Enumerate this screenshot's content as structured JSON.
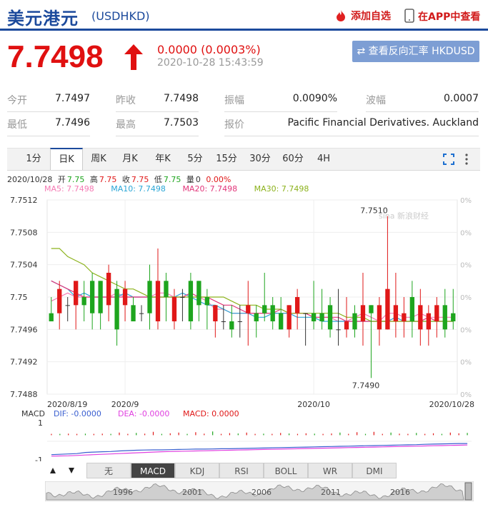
{
  "header": {
    "name": "美元港元",
    "code": "(USDHKD)",
    "watch_label": "添加自选",
    "app_label": "在APP中查看"
  },
  "quote": {
    "price": "7.7498",
    "change": "0.0000 (0.0003%)",
    "time": "2020-10-28 15:43:59",
    "reverse_label": "⇄ 查看反向汇率 HKDUSD",
    "up_color": "#e01010"
  },
  "stats": {
    "row1": [
      {
        "label": "今开",
        "value": "7.7497"
      },
      {
        "label": "昨收",
        "value": "7.7498"
      },
      {
        "label": "振幅",
        "value": "0.0090%"
      },
      {
        "label": "波幅",
        "value": "0.0007"
      }
    ],
    "row2": [
      {
        "label": "最低",
        "value": "7.7496"
      },
      {
        "label": "最高",
        "value": "7.7503"
      },
      {
        "label": "报价",
        "value": "Pacific Financial Derivatives. Auckland"
      }
    ]
  },
  "tabs": [
    "1分",
    "日K",
    "周K",
    "月K",
    "年K",
    "5分",
    "15分",
    "30分",
    "60分",
    "4H"
  ],
  "active_tab": 1,
  "ohlc": {
    "date": "2020/10/28",
    "open_label": "开",
    "open": "7.75",
    "high_label": "高",
    "high": "7.75",
    "close_label": "收",
    "close": "7.75",
    "low_label": "低",
    "low": "7.75",
    "vol_label": "量",
    "vol": "0",
    "pct": "0.00%"
  },
  "ma_legend": [
    {
      "label": "MA5: 7.7498",
      "color": "#f57ab4"
    },
    {
      "label": "MA10: 7.7498",
      "color": "#2aa6d6"
    },
    {
      "label": "MA20: 7.7498",
      "color": "#e2367a"
    },
    {
      "label": "MA30: 7.7498",
      "color": "#8cb21c"
    }
  ],
  "watermark": "sina 新浪财经",
  "macd_legend": {
    "title": "MACD",
    "dif": "DIF: -0.0000",
    "dea": "DEA: -0.0000",
    "macd": "MACD: 0.0000"
  },
  "indicator_tabs": [
    "无",
    "MACD",
    "KDJ",
    "RSI",
    "BOLL",
    "WR",
    "DMI"
  ],
  "active_indicator": 1,
  "navigator": {
    "years": [
      "1996",
      "2001",
      "2006",
      "2011",
      "2016"
    ]
  },
  "chart_data": {
    "type": "candlestick",
    "y_ticks": [
      "7.7512",
      "7.7508",
      "7.7504",
      "7.75",
      "7.7496",
      "7.7492",
      "7.7488"
    ],
    "ylim": [
      7.7488,
      7.7512
    ],
    "right_ticks": [
      "0%",
      "0%",
      "0%",
      "0%",
      "0%",
      "0%",
      "0%"
    ],
    "x_labels": [
      "2020/8/19",
      "2020/9",
      "2020/10",
      "2020/10/28"
    ],
    "x_label_index": [
      0,
      9,
      32,
      49
    ],
    "annotations": [
      {
        "text": "7.7510",
        "index": 39,
        "value": 7.751
      },
      {
        "text": "7.7490",
        "index": 38,
        "value": 7.749
      }
    ],
    "colors": {
      "up": "#e01818",
      "down": "#1ea51e",
      "flat": "#333333"
    },
    "candles": [
      {
        "o": 7.7498,
        "h": 7.75,
        "l": 7.7497,
        "c": 7.7497
      },
      {
        "o": 7.7498,
        "h": 7.7502,
        "l": 7.7496,
        "c": 7.7501
      },
      {
        "o": 7.7499,
        "h": 7.75,
        "l": 7.7497,
        "c": 7.7499
      },
      {
        "o": 7.7499,
        "h": 7.7501,
        "l": 7.7496,
        "c": 7.7502
      },
      {
        "o": 7.75,
        "h": 7.7502,
        "l": 7.7497,
        "c": 7.7499
      },
      {
        "o": 7.7502,
        "h": 7.7503,
        "l": 7.7496,
        "c": 7.7498
      },
      {
        "o": 7.7502,
        "h": 7.7502,
        "l": 7.7496,
        "c": 7.7498
      },
      {
        "o": 7.7499,
        "h": 7.7504,
        "l": 7.7497,
        "c": 7.7503
      },
      {
        "o": 7.7501,
        "h": 7.7502,
        "l": 7.7494,
        "c": 7.7496
      },
      {
        "o": 7.7499,
        "h": 7.7502,
        "l": 7.7497,
        "c": 7.7501
      },
      {
        "o": 7.7499,
        "h": 7.75,
        "l": 7.7497,
        "c": 7.7497
      },
      {
        "o": 7.7498,
        "h": 7.7499,
        "l": 7.7497,
        "c": 7.7498
      },
      {
        "o": 7.7502,
        "h": 7.7504,
        "l": 7.7496,
        "c": 7.7498
      },
      {
        "o": 7.7497,
        "h": 7.7506,
        "l": 7.7496,
        "c": 7.7502
      },
      {
        "o": 7.7502,
        "h": 7.7503,
        "l": 7.7497,
        "c": 7.75
      },
      {
        "o": 7.7497,
        "h": 7.7501,
        "l": 7.7496,
        "c": 7.75
      },
      {
        "o": 7.75,
        "h": 7.7501,
        "l": 7.7497,
        "c": 7.75
      },
      {
        "o": 7.7502,
        "h": 7.7503,
        "l": 7.7496,
        "c": 7.7497
      },
      {
        "o": 7.7502,
        "h": 7.7502,
        "l": 7.7497,
        "c": 7.7499
      },
      {
        "o": 7.75,
        "h": 7.7501,
        "l": 7.7496,
        "c": 7.7499
      },
      {
        "o": 7.7497,
        "h": 7.7499,
        "l": 7.7495,
        "c": 7.7499
      },
      {
        "o": 7.7497,
        "h": 7.7499,
        "l": 7.7496,
        "c": 7.7497
      },
      {
        "o": 7.7497,
        "h": 7.7499,
        "l": 7.7495,
        "c": 7.7496
      },
      {
        "o": 7.7497,
        "h": 7.7499,
        "l": 7.7495,
        "c": 7.7497
      },
      {
        "o": 7.7498,
        "h": 7.7502,
        "l": 7.7494,
        "c": 7.7499
      },
      {
        "o": 7.7498,
        "h": 7.7499,
        "l": 7.7495,
        "c": 7.7497
      },
      {
        "o": 7.7499,
        "h": 7.7503,
        "l": 7.7497,
        "c": 7.7498
      },
      {
        "o": 7.7499,
        "h": 7.75,
        "l": 7.7496,
        "c": 7.7497
      },
      {
        "o": 7.7498,
        "h": 7.75,
        "l": 7.7496,
        "c": 7.7496
      },
      {
        "o": 7.7496,
        "h": 7.7499,
        "l": 7.7495,
        "c": 7.7499
      },
      {
        "o": 7.7498,
        "h": 7.7501,
        "l": 7.7496,
        "c": 7.75
      },
      {
        "o": 7.7498,
        "h": 7.7498,
        "l": 7.7494,
        "c": 7.7498
      },
      {
        "o": 7.7498,
        "h": 7.7502,
        "l": 7.7496,
        "c": 7.7497
      },
      {
        "o": 7.7498,
        "h": 7.7501,
        "l": 7.7496,
        "c": 7.7497
      },
      {
        "o": 7.7499,
        "h": 7.75,
        "l": 7.7495,
        "c": 7.7496
      },
      {
        "o": 7.7496,
        "h": 7.7501,
        "l": 7.7494,
        "c": 7.7496
      },
      {
        "o": 7.7496,
        "h": 7.75,
        "l": 7.7495,
        "c": 7.7497
      },
      {
        "o": 7.7498,
        "h": 7.7499,
        "l": 7.7495,
        "c": 7.7496
      },
      {
        "o": 7.7497,
        "h": 7.7503,
        "l": 7.7494,
        "c": 7.7499
      },
      {
        "o": 7.7499,
        "h": 7.7499,
        "l": 7.749,
        "c": 7.7498
      },
      {
        "o": 7.7496,
        "h": 7.75,
        "l": 7.7494,
        "c": 7.7499
      },
      {
        "o": 7.7496,
        "h": 7.751,
        "l": 7.7496,
        "c": 7.7501
      },
      {
        "o": 7.7497,
        "h": 7.7503,
        "l": 7.7495,
        "c": 7.7499
      },
      {
        "o": 7.7497,
        "h": 7.75,
        "l": 7.7495,
        "c": 7.7498
      },
      {
        "o": 7.75,
        "h": 7.7502,
        "l": 7.7495,
        "c": 7.7497
      },
      {
        "o": 7.7496,
        "h": 7.7501,
        "l": 7.7494,
        "c": 7.7499
      },
      {
        "o": 7.7496,
        "h": 7.7499,
        "l": 7.7494,
        "c": 7.7498
      },
      {
        "o": 7.7497,
        "h": 7.75,
        "l": 7.7495,
        "c": 7.7499
      },
      {
        "o": 7.7499,
        "h": 7.7501,
        "l": 7.7495,
        "c": 7.7496
      },
      {
        "o": 7.7498,
        "h": 7.7501,
        "l": 7.7496,
        "c": 7.7497
      }
    ],
    "ma": [
      {
        "name": "MA5",
        "color": "#f57ab4",
        "values": [
          7.74995,
          7.75,
          7.75005,
          7.75,
          7.75,
          7.75,
          7.75,
          7.75,
          7.75005,
          7.75,
          7.75,
          7.75,
          7.75,
          7.75005,
          7.75005,
          7.75,
          7.75,
          7.75,
          7.75,
          7.74995,
          7.74985,
          7.74985,
          7.7498,
          7.7498,
          7.7498,
          7.7498,
          7.7498,
          7.7498,
          7.7498,
          7.7498,
          7.7498,
          7.7498,
          7.74975,
          7.74975,
          7.74975,
          7.7497,
          7.7497,
          7.74975,
          7.7498,
          7.74975,
          7.7497,
          7.7498,
          7.7498,
          7.74975,
          7.74975,
          7.7498,
          7.74975,
          7.74975,
          7.74975,
          7.74975
        ]
      },
      {
        "name": "MA10",
        "color": "#2aa6d6",
        "values": [
          7.7502,
          7.75015,
          7.7501,
          7.75,
          7.75005,
          7.75,
          7.75,
          7.75,
          7.75,
          7.75005,
          7.75,
          7.75,
          7.75,
          7.75,
          7.75,
          7.75,
          7.75005,
          7.75,
          7.74995,
          7.7499,
          7.7499,
          7.74985,
          7.7498,
          7.7498,
          7.7498,
          7.74975,
          7.74975,
          7.7498,
          7.7498,
          7.7498,
          7.74975,
          7.74975,
          7.74975,
          7.7497,
          7.7497,
          7.7497,
          7.7497,
          7.7497,
          7.7497,
          7.7497,
          7.7497,
          7.7497,
          7.74975,
          7.7497,
          7.7497,
          7.7497,
          7.7497,
          7.7497,
          7.7497,
          7.7497
        ]
      },
      {
        "name": "MA20",
        "color": "#e2367a",
        "values": [
          7.7502,
          7.75015,
          7.7501,
          7.75005,
          7.75,
          7.75,
          7.75,
          7.75,
          7.75,
          7.75,
          7.75,
          7.75,
          7.75,
          7.75,
          7.75,
          7.75,
          7.75,
          7.75005,
          7.75,
          7.75,
          7.74995,
          7.7499,
          7.7499,
          7.74985,
          7.7498,
          7.7498,
          7.7498,
          7.7498,
          7.74985,
          7.7498,
          7.7498,
          7.7498,
          7.74975,
          7.74975,
          7.74975,
          7.74975,
          7.7497,
          7.7497,
          7.7497,
          7.7497,
          7.7497,
          7.7497,
          7.7497,
          7.7497,
          7.7497,
          7.7497,
          7.74975,
          7.7497,
          7.7497,
          7.7497
        ]
      },
      {
        "name": "MA30",
        "color": "#8cb21c",
        "values": [
          7.7506,
          7.7506,
          7.7505,
          7.75045,
          7.7504,
          7.7503,
          7.75025,
          7.7502,
          7.75015,
          7.7501,
          7.7501,
          7.75005,
          7.75,
          7.75,
          7.75,
          7.75,
          7.75,
          7.75,
          7.75,
          7.75,
          7.75,
          7.75,
          7.74995,
          7.7499,
          7.7499,
          7.7499,
          7.74985,
          7.74985,
          7.74985,
          7.7498,
          7.7498,
          7.7498,
          7.7498,
          7.7498,
          7.7498,
          7.7498,
          7.74975,
          7.74975,
          7.74975,
          7.7497,
          7.7497,
          7.7497,
          7.7497,
          7.7497,
          7.7497,
          7.7497,
          7.7497,
          7.7497,
          7.7497,
          7.7497
        ]
      }
    ],
    "macd": {
      "ylim": [
        -1,
        1
      ],
      "y_ticks": [
        "1",
        "-1"
      ],
      "dif": [
        -0.72,
        -0.7,
        -0.68,
        -0.66,
        -0.6,
        -0.58,
        -0.56,
        -0.55,
        -0.52,
        -0.5,
        -0.48,
        -0.47,
        -0.46,
        -0.46,
        -0.45,
        -0.44,
        -0.43,
        -0.42,
        -0.42,
        -0.41,
        -0.4,
        -0.4,
        -0.39,
        -0.38,
        -0.37,
        -0.36,
        -0.35,
        -0.34,
        -0.33,
        -0.32,
        -0.31,
        -0.3,
        -0.29,
        -0.28,
        -0.27,
        -0.26,
        -0.25,
        -0.24,
        -0.23,
        -0.22,
        -0.21,
        -0.2,
        -0.19,
        -0.18,
        -0.16,
        -0.15,
        -0.14,
        -0.13,
        -0.12,
        -0.12
      ],
      "dea": [
        -0.8,
        -0.79,
        -0.78,
        -0.76,
        -0.74,
        -0.72,
        -0.7,
        -0.68,
        -0.66,
        -0.64,
        -0.62,
        -0.6,
        -0.58,
        -0.56,
        -0.55,
        -0.54,
        -0.53,
        -0.52,
        -0.51,
        -0.5,
        -0.49,
        -0.48,
        -0.47,
        -0.46,
        -0.45,
        -0.44,
        -0.43,
        -0.42,
        -0.41,
        -0.4,
        -0.39,
        -0.38,
        -0.37,
        -0.36,
        -0.35,
        -0.34,
        -0.33,
        -0.32,
        -0.31,
        -0.3,
        -0.29,
        -0.28,
        -0.27,
        -0.26,
        -0.25,
        -0.24,
        -0.23,
        -0.22,
        -0.21,
        -0.2
      ],
      "hist": [
        0.05,
        0.05,
        0.06,
        0.05,
        0.06,
        0.05,
        0.06,
        0.05,
        0.12,
        0.05,
        0.1,
        0.06,
        0.16,
        0.05,
        0.08,
        0.12,
        0.05,
        0.14,
        0.06,
        0.18,
        0.05,
        0.09,
        0.07,
        0.12,
        0.05,
        0.06,
        0.05,
        0.1,
        0.07,
        0.05,
        0.08,
        0.06,
        0.05,
        0.07,
        0.12,
        0.05,
        0.14,
        0.05,
        0.16,
        0.05,
        0.12,
        0.06,
        0.05,
        0.1,
        0.05,
        0.08,
        0.05,
        0.12,
        0.08,
        0.1
      ],
      "hist_colors": {
        "up": "#e01818",
        "down": "#1ea51e"
      }
    }
  }
}
